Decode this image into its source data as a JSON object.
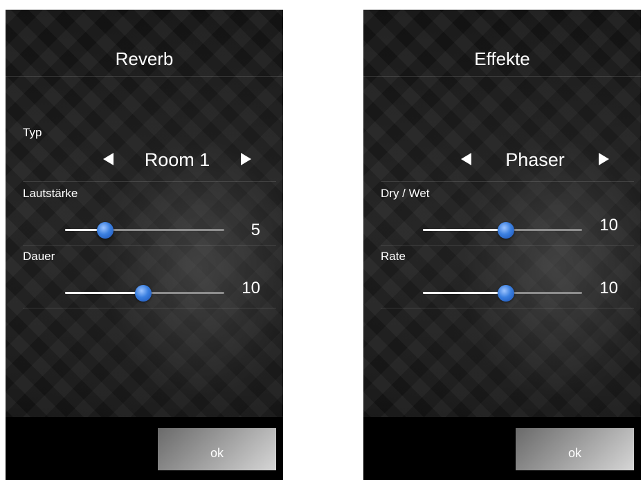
{
  "dialogs": [
    {
      "title": "Reverb",
      "selector": {
        "label": "Typ",
        "value": "Room 1"
      },
      "sliders": [
        {
          "label": "Lautstärke",
          "value_text": "5",
          "fraction": 0.25
        },
        {
          "label": "Dauer",
          "value_text": "10",
          "fraction": 0.49
        }
      ],
      "ok_label": "ok"
    },
    {
      "title": "Effekte",
      "selector": {
        "label": "",
        "value": "Phaser"
      },
      "sliders": [
        {
          "label": "Dry / Wet",
          "value_text": "10",
          "fraction": 0.52
        },
        {
          "label": "Rate",
          "value_text": "10",
          "fraction": 0.52
        }
      ],
      "ok_label": "ok"
    }
  ],
  "colors": {
    "background": "#000000",
    "text": "#ffffff",
    "slider_thumb": "#3a7fe0",
    "slider_track": "#8e8e8e",
    "slider_fill": "#ffffff"
  },
  "icons": {
    "previous": "triangle-left-icon",
    "next": "triangle-right-icon"
  }
}
